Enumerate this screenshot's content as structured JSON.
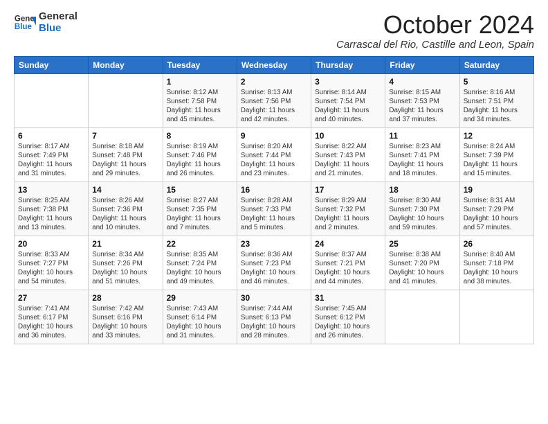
{
  "logo": {
    "line1": "General",
    "line2": "Blue"
  },
  "title": "October 2024",
  "location": "Carrascal del Rio, Castille and Leon, Spain",
  "headers": [
    "Sunday",
    "Monday",
    "Tuesday",
    "Wednesday",
    "Thursday",
    "Friday",
    "Saturday"
  ],
  "weeks": [
    [
      {
        "day": "",
        "info": ""
      },
      {
        "day": "",
        "info": ""
      },
      {
        "day": "1",
        "info": "Sunrise: 8:12 AM\nSunset: 7:58 PM\nDaylight: 11 hours and 45 minutes."
      },
      {
        "day": "2",
        "info": "Sunrise: 8:13 AM\nSunset: 7:56 PM\nDaylight: 11 hours and 42 minutes."
      },
      {
        "day": "3",
        "info": "Sunrise: 8:14 AM\nSunset: 7:54 PM\nDaylight: 11 hours and 40 minutes."
      },
      {
        "day": "4",
        "info": "Sunrise: 8:15 AM\nSunset: 7:53 PM\nDaylight: 11 hours and 37 minutes."
      },
      {
        "day": "5",
        "info": "Sunrise: 8:16 AM\nSunset: 7:51 PM\nDaylight: 11 hours and 34 minutes."
      }
    ],
    [
      {
        "day": "6",
        "info": "Sunrise: 8:17 AM\nSunset: 7:49 PM\nDaylight: 11 hours and 31 minutes."
      },
      {
        "day": "7",
        "info": "Sunrise: 8:18 AM\nSunset: 7:48 PM\nDaylight: 11 hours and 29 minutes."
      },
      {
        "day": "8",
        "info": "Sunrise: 8:19 AM\nSunset: 7:46 PM\nDaylight: 11 hours and 26 minutes."
      },
      {
        "day": "9",
        "info": "Sunrise: 8:20 AM\nSunset: 7:44 PM\nDaylight: 11 hours and 23 minutes."
      },
      {
        "day": "10",
        "info": "Sunrise: 8:22 AM\nSunset: 7:43 PM\nDaylight: 11 hours and 21 minutes."
      },
      {
        "day": "11",
        "info": "Sunrise: 8:23 AM\nSunset: 7:41 PM\nDaylight: 11 hours and 18 minutes."
      },
      {
        "day": "12",
        "info": "Sunrise: 8:24 AM\nSunset: 7:39 PM\nDaylight: 11 hours and 15 minutes."
      }
    ],
    [
      {
        "day": "13",
        "info": "Sunrise: 8:25 AM\nSunset: 7:38 PM\nDaylight: 11 hours and 13 minutes."
      },
      {
        "day": "14",
        "info": "Sunrise: 8:26 AM\nSunset: 7:36 PM\nDaylight: 11 hours and 10 minutes."
      },
      {
        "day": "15",
        "info": "Sunrise: 8:27 AM\nSunset: 7:35 PM\nDaylight: 11 hours and 7 minutes."
      },
      {
        "day": "16",
        "info": "Sunrise: 8:28 AM\nSunset: 7:33 PM\nDaylight: 11 hours and 5 minutes."
      },
      {
        "day": "17",
        "info": "Sunrise: 8:29 AM\nSunset: 7:32 PM\nDaylight: 11 hours and 2 minutes."
      },
      {
        "day": "18",
        "info": "Sunrise: 8:30 AM\nSunset: 7:30 PM\nDaylight: 10 hours and 59 minutes."
      },
      {
        "day": "19",
        "info": "Sunrise: 8:31 AM\nSunset: 7:29 PM\nDaylight: 10 hours and 57 minutes."
      }
    ],
    [
      {
        "day": "20",
        "info": "Sunrise: 8:33 AM\nSunset: 7:27 PM\nDaylight: 10 hours and 54 minutes."
      },
      {
        "day": "21",
        "info": "Sunrise: 8:34 AM\nSunset: 7:26 PM\nDaylight: 10 hours and 51 minutes."
      },
      {
        "day": "22",
        "info": "Sunrise: 8:35 AM\nSunset: 7:24 PM\nDaylight: 10 hours and 49 minutes."
      },
      {
        "day": "23",
        "info": "Sunrise: 8:36 AM\nSunset: 7:23 PM\nDaylight: 10 hours and 46 minutes."
      },
      {
        "day": "24",
        "info": "Sunrise: 8:37 AM\nSunset: 7:21 PM\nDaylight: 10 hours and 44 minutes."
      },
      {
        "day": "25",
        "info": "Sunrise: 8:38 AM\nSunset: 7:20 PM\nDaylight: 10 hours and 41 minutes."
      },
      {
        "day": "26",
        "info": "Sunrise: 8:40 AM\nSunset: 7:18 PM\nDaylight: 10 hours and 38 minutes."
      }
    ],
    [
      {
        "day": "27",
        "info": "Sunrise: 7:41 AM\nSunset: 6:17 PM\nDaylight: 10 hours and 36 minutes."
      },
      {
        "day": "28",
        "info": "Sunrise: 7:42 AM\nSunset: 6:16 PM\nDaylight: 10 hours and 33 minutes."
      },
      {
        "day": "29",
        "info": "Sunrise: 7:43 AM\nSunset: 6:14 PM\nDaylight: 10 hours and 31 minutes."
      },
      {
        "day": "30",
        "info": "Sunrise: 7:44 AM\nSunset: 6:13 PM\nDaylight: 10 hours and 28 minutes."
      },
      {
        "day": "31",
        "info": "Sunrise: 7:45 AM\nSunset: 6:12 PM\nDaylight: 10 hours and 26 minutes."
      },
      {
        "day": "",
        "info": ""
      },
      {
        "day": "",
        "info": ""
      }
    ]
  ]
}
